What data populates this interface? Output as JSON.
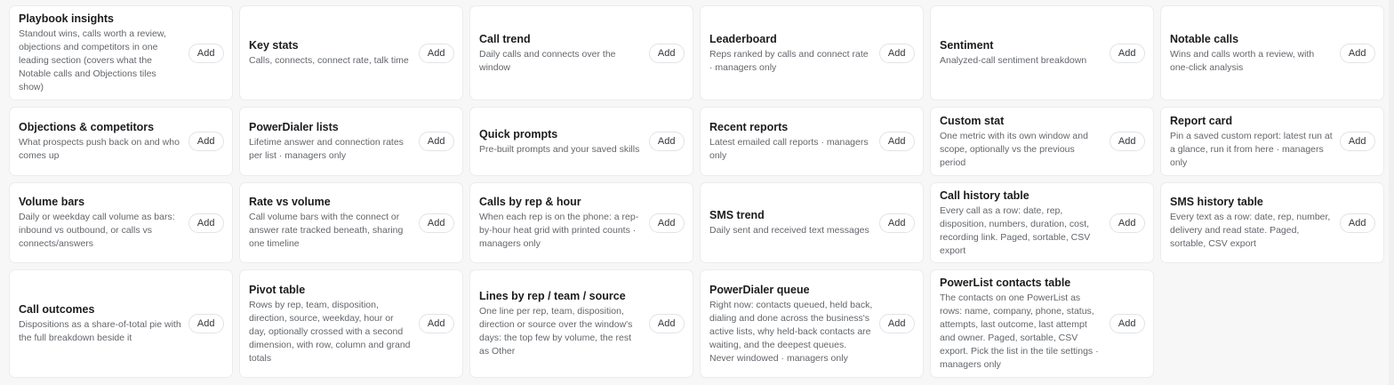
{
  "tiles": [
    {
      "title": "Playbook insights",
      "description": "Standout wins, calls worth a review, objections and competitors in one leading section (covers what the Notable calls and Objections tiles show)",
      "add_label": "Add"
    },
    {
      "title": "Key stats",
      "description": "Calls, connects, connect rate, talk time",
      "add_label": "Add"
    },
    {
      "title": "Call trend",
      "description": "Daily calls and connects over the window",
      "add_label": "Add"
    },
    {
      "title": "Leaderboard",
      "description": "Reps ranked by calls and connect rate · managers only",
      "add_label": "Add"
    },
    {
      "title": "Sentiment",
      "description": "Analyzed-call sentiment breakdown",
      "add_label": "Add"
    },
    {
      "title": "Notable calls",
      "description": "Wins and calls worth a review, with one-click analysis",
      "add_label": "Add"
    },
    {
      "title": "Objections & competitors",
      "description": "What prospects push back on and who comes up",
      "add_label": "Add"
    },
    {
      "title": "PowerDialer lists",
      "description": "Lifetime answer and connection rates per list · managers only",
      "add_label": "Add"
    },
    {
      "title": "Quick prompts",
      "description": "Pre-built prompts and your saved skills",
      "add_label": "Add"
    },
    {
      "title": "Recent reports",
      "description": "Latest emailed call reports · managers only",
      "add_label": "Add"
    },
    {
      "title": "Custom stat",
      "description": "One metric with its own window and scope, optionally vs the previous period",
      "add_label": "Add"
    },
    {
      "title": "Report card",
      "description": "Pin a saved custom report: latest run at a glance, run it from here · managers only",
      "add_label": "Add"
    },
    {
      "title": "Volume bars",
      "description": "Daily or weekday call volume as bars: inbound vs outbound, or calls vs connects/answers",
      "add_label": "Add"
    },
    {
      "title": "Rate vs volume",
      "description": "Call volume bars with the connect or answer rate tracked beneath, sharing one timeline",
      "add_label": "Add"
    },
    {
      "title": "Calls by rep & hour",
      "description": "When each rep is on the phone: a rep-by-hour heat grid with printed counts · managers only",
      "add_label": "Add"
    },
    {
      "title": "SMS trend",
      "description": "Daily sent and received text messages",
      "add_label": "Add"
    },
    {
      "title": "Call history table",
      "description": "Every call as a row: date, rep, disposition, numbers, duration, cost, recording link. Paged, sortable, CSV export",
      "add_label": "Add"
    },
    {
      "title": "SMS history table",
      "description": "Every text as a row: date, rep, number, delivery and read state. Paged, sortable, CSV export",
      "add_label": "Add"
    },
    {
      "title": "Call outcomes",
      "description": "Dispositions as a share-of-total pie with the full breakdown beside it",
      "add_label": "Add"
    },
    {
      "title": "Pivot table",
      "description": "Rows by rep, team, disposition, direction, source, weekday, hour or day, optionally crossed with a second dimension, with row, column and grand totals",
      "add_label": "Add"
    },
    {
      "title": "Lines by rep / team / source",
      "description": "One line per rep, team, disposition, direction or source over the window's days: the top few by volume, the rest as Other",
      "add_label": "Add"
    },
    {
      "title": "PowerDialer queue",
      "description": "Right now: contacts queued, held back, dialing and done across the business's active lists, why held-back contacts are waiting, and the deepest queues. Never windowed · managers only",
      "add_label": "Add"
    },
    {
      "title": "PowerList contacts table",
      "description": "The contacts on one PowerList as rows: name, company, phone, status, attempts, last outcome, last attempt and owner. Paged, sortable, CSV export. Pick the list in the tile settings · managers only",
      "add_label": "Add"
    }
  ]
}
